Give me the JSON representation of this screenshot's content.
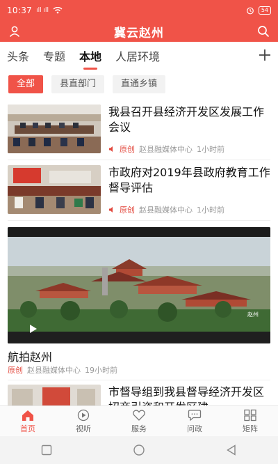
{
  "status_bar": {
    "time": "10:37",
    "signal_text": "ıll ıll",
    "battery": "54"
  },
  "header": {
    "title": "冀云赵州",
    "user_icon": "user-icon",
    "search_icon": "search-icon"
  },
  "tabs": [
    {
      "label": "头条",
      "active": false
    },
    {
      "label": "专题",
      "active": false
    },
    {
      "label": "本地",
      "active": true
    },
    {
      "label": "人居环境",
      "active": false
    }
  ],
  "tab_add_icon": "plus-icon",
  "chips": [
    {
      "label": "全部",
      "active": true
    },
    {
      "label": "县直部门",
      "active": false
    },
    {
      "label": "直通乡镇",
      "active": false
    }
  ],
  "news": [
    {
      "title": "我县召开县经济开发区发展工作会议",
      "tag": "原创",
      "source": "赵县融媒体中心",
      "time": "1小时前"
    },
    {
      "title": "市政府对2019年县政府教育工作督导评估",
      "tag": "原创",
      "source": "赵县融媒体中心",
      "time": "1小时前"
    }
  ],
  "video": {
    "title": "航拍赵州",
    "tag": "原创",
    "source": "赵县融媒体中心",
    "time": "19小时前",
    "watermark": "赵州"
  },
  "partial_news": {
    "title": "市督导组到我县督导经济开发区招商引资和开发区建"
  },
  "bottom_nav": [
    {
      "label": "首页",
      "icon": "home-icon",
      "active": true
    },
    {
      "label": "视听",
      "icon": "play-icon",
      "active": false
    },
    {
      "label": "服务",
      "icon": "heart-icon",
      "active": false
    },
    {
      "label": "问政",
      "icon": "chat-icon",
      "active": false
    },
    {
      "label": "矩阵",
      "icon": "grid-icon",
      "active": false
    }
  ],
  "colors": {
    "brand": "#f05348",
    "original_tag": "#e2463b"
  }
}
